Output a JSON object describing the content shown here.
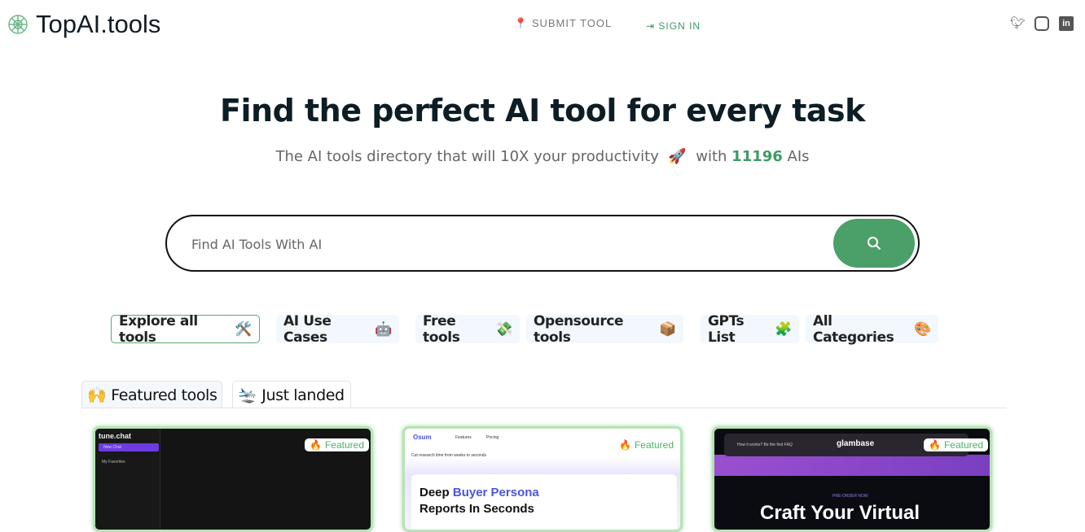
{
  "header": {
    "logo": "TopAI.tools",
    "submit": "SUBMIT TOOL",
    "signin": "SIGN IN",
    "social": [
      "twitter-icon",
      "instagram-icon",
      "linkedin-icon"
    ]
  },
  "hero": {
    "title": "Find the perfect AI tool for every task",
    "subtitle": "The AI tools directory that will 10X your productivity",
    "with": "with",
    "count": "11196",
    "unit": "AIs"
  },
  "search": {
    "placeholder": "Find AI Tools With AI"
  },
  "pills": [
    {
      "label": "Explore all tools",
      "emoji": "🛠️"
    },
    {
      "label": "AI Use Cases",
      "emoji": "🤖"
    },
    {
      "label": "Free tools",
      "emoji": "💸"
    },
    {
      "label": "Opensource tools",
      "emoji": "📦"
    },
    {
      "label": "GPTs List",
      "emoji": "🧩"
    },
    {
      "label": "All Categories",
      "emoji": "🎨"
    }
  ],
  "tabs": [
    {
      "label": "Featured tools",
      "emoji": "🙌"
    },
    {
      "label": "Just landed",
      "emoji": "🛬"
    }
  ],
  "cards": [
    {
      "badge": "Featured",
      "brand": "tune.chat",
      "btn": "New Chat",
      "item": "My Favorites"
    },
    {
      "badge": "Featured",
      "brand": "Osum",
      "nav1": "Features",
      "nav2": "Pricing",
      "tag": "Cut research time from weeks to seconds",
      "h1": "Deep ",
      "h1b": "Buyer Persona",
      "h2": "Reports In Seconds"
    },
    {
      "badge": "Featured",
      "brand": "glambase",
      "nav": "How it works?   Be the first   FAQ",
      "pre": "PRE-ORDER NOW",
      "h": "Craft Your Virtual"
    }
  ],
  "colors": {
    "accent": "#4b9f69",
    "card_border": "#b6e3b6"
  }
}
